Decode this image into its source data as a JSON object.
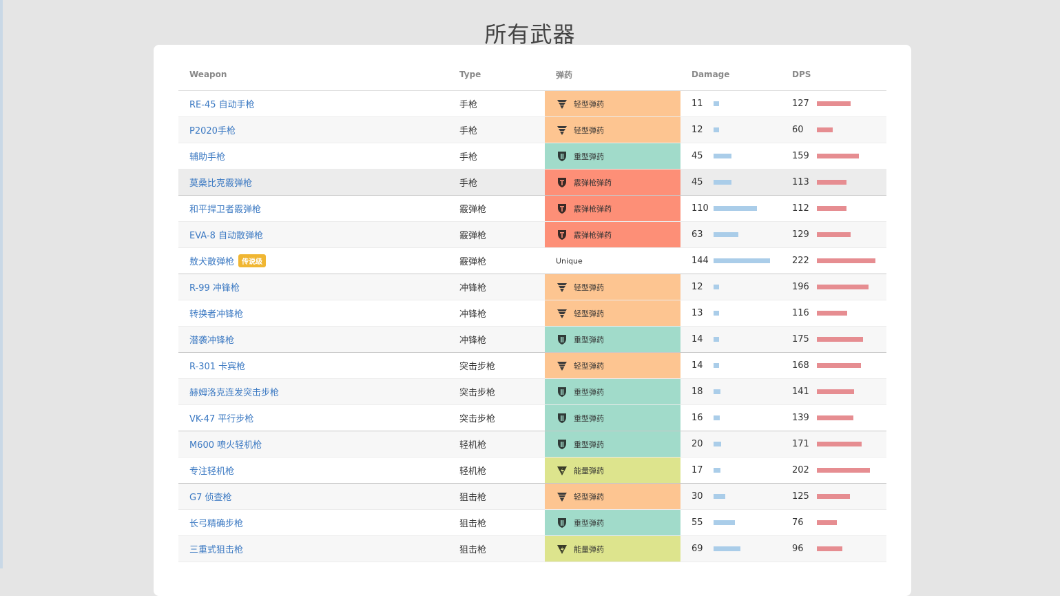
{
  "page": {
    "title": "所有武器"
  },
  "table": {
    "headers": {
      "weapon": "Weapon",
      "type": "Type",
      "ammo": "弹药",
      "damage": "Damage",
      "dps": "DPS"
    },
    "max_damage": 144,
    "max_dps": 222,
    "rows": [
      {
        "name": "RE-45 自动手枪",
        "type": "手枪",
        "ammo": "轻型弹药",
        "ammo_kind": "light",
        "damage": "11",
        "dps": "127"
      },
      {
        "name": "P2020手枪",
        "type": "手枪",
        "ammo": "轻型弹药",
        "ammo_kind": "light",
        "damage": "12",
        "dps": "60"
      },
      {
        "name": "辅助手枪",
        "type": "手枪",
        "ammo": "重型弹药",
        "ammo_kind": "heavy",
        "damage": "45",
        "dps": "159"
      },
      {
        "name": "莫桑比克霰弹枪",
        "type": "手枪",
        "ammo": "霰弹枪弹药",
        "ammo_kind": "shotgun",
        "damage": "45",
        "dps": "113"
      },
      {
        "name": "和平捍卫者霰弹枪",
        "type": "霰弹枪",
        "ammo": "霰弹枪弹药",
        "ammo_kind": "shotgun",
        "damage": "110",
        "dps": "112"
      },
      {
        "name": "EVA-8 自动散弹枪",
        "type": "霰弹枪",
        "ammo": "霰弹枪弹药",
        "ammo_kind": "shotgun",
        "damage": "63",
        "dps": "129"
      },
      {
        "name": "敖犬散弹枪",
        "badge": "传说级",
        "type": "霰弹枪",
        "ammo": "Unique",
        "ammo_kind": "unique",
        "damage": "144",
        "dps": "222"
      },
      {
        "name": "R-99 冲锋枪",
        "type": "冲锋枪",
        "ammo": "轻型弹药",
        "ammo_kind": "light",
        "damage": "12",
        "dps": "196"
      },
      {
        "name": "转换者冲锋枪",
        "type": "冲锋枪",
        "ammo": "轻型弹药",
        "ammo_kind": "light",
        "damage": "13",
        "dps": "116"
      },
      {
        "name": "潜袭冲锋枪",
        "type": "冲锋枪",
        "ammo": "重型弹药",
        "ammo_kind": "heavy",
        "damage": "14",
        "dps": "175"
      },
      {
        "name": "R-301 卡宾枪",
        "type": "突击步枪",
        "ammo": "轻型弹药",
        "ammo_kind": "light",
        "damage": "14",
        "dps": "168"
      },
      {
        "name": "赫姆洛克连发突击步枪",
        "type": "突击步枪",
        "ammo": "重型弹药",
        "ammo_kind": "heavy",
        "damage": "18",
        "dps": "141"
      },
      {
        "name": "VK-47 平行步枪",
        "type": "突击步枪",
        "ammo": "重型弹药",
        "ammo_kind": "heavy",
        "damage": "16",
        "dps": "139"
      },
      {
        "name": "M600 喷火轻机枪",
        "type": "轻机枪",
        "ammo": "重型弹药",
        "ammo_kind": "heavy",
        "damage": "20",
        "dps": "171"
      },
      {
        "name": "专注轻机枪",
        "type": "轻机枪",
        "ammo": "能量弹药",
        "ammo_kind": "energy",
        "damage": "17",
        "dps": "202"
      },
      {
        "name": "G7 侦查枪",
        "type": "狙击枪",
        "ammo": "轻型弹药",
        "ammo_kind": "light",
        "damage": "30",
        "dps": "125"
      },
      {
        "name": "长弓精确步枪",
        "type": "狙击枪",
        "ammo": "重型弹药",
        "ammo_kind": "heavy",
        "damage": "55",
        "dps": "76"
      },
      {
        "name": "三重式狙击枪",
        "type": "狙击枪",
        "ammo": "能量弹药",
        "ammo_kind": "energy",
        "damage": "69",
        "dps": "96"
      }
    ]
  },
  "colors": {
    "light": "#fdc591",
    "heavy": "#a1dbca",
    "shotgun": "#fd8f77",
    "energy": "#dde48d",
    "damage_bar": "#aacde9",
    "dps_bar": "#e68d91"
  },
  "icons": {
    "light": "light-ammo-icon",
    "heavy": "heavy-ammo-icon",
    "shotgun": "shotgun-ammo-icon",
    "energy": "energy-ammo-icon"
  }
}
